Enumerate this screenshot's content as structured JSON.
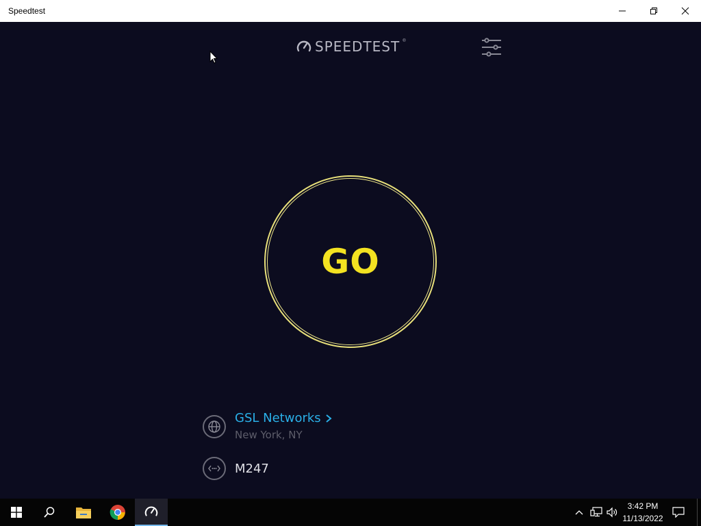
{
  "window": {
    "title": "Speedtest",
    "controls": {
      "minimize": "minimize",
      "restore": "restore",
      "close": "close"
    }
  },
  "app": {
    "logo_text": "SPEEDTEST",
    "logo_registered": "®",
    "go_label": "GO",
    "server": {
      "name": "GSL Networks",
      "location": "New York, NY"
    },
    "connection": {
      "name": "M247"
    },
    "colors": {
      "background": "#0c0c1f",
      "accent_yellow": "#f3e221",
      "link_blue": "#2ab0e8"
    }
  },
  "taskbar": {
    "items": [
      {
        "name": "start",
        "icon": "windows-logo-icon"
      },
      {
        "name": "search",
        "icon": "search-icon"
      },
      {
        "name": "file-explorer",
        "icon": "folder-icon"
      },
      {
        "name": "chrome",
        "icon": "chrome-icon"
      },
      {
        "name": "speedtest",
        "icon": "speedtest-gauge-icon",
        "active": true
      }
    ],
    "tray": {
      "time": "3:42 PM",
      "date": "11/13/2022"
    }
  }
}
